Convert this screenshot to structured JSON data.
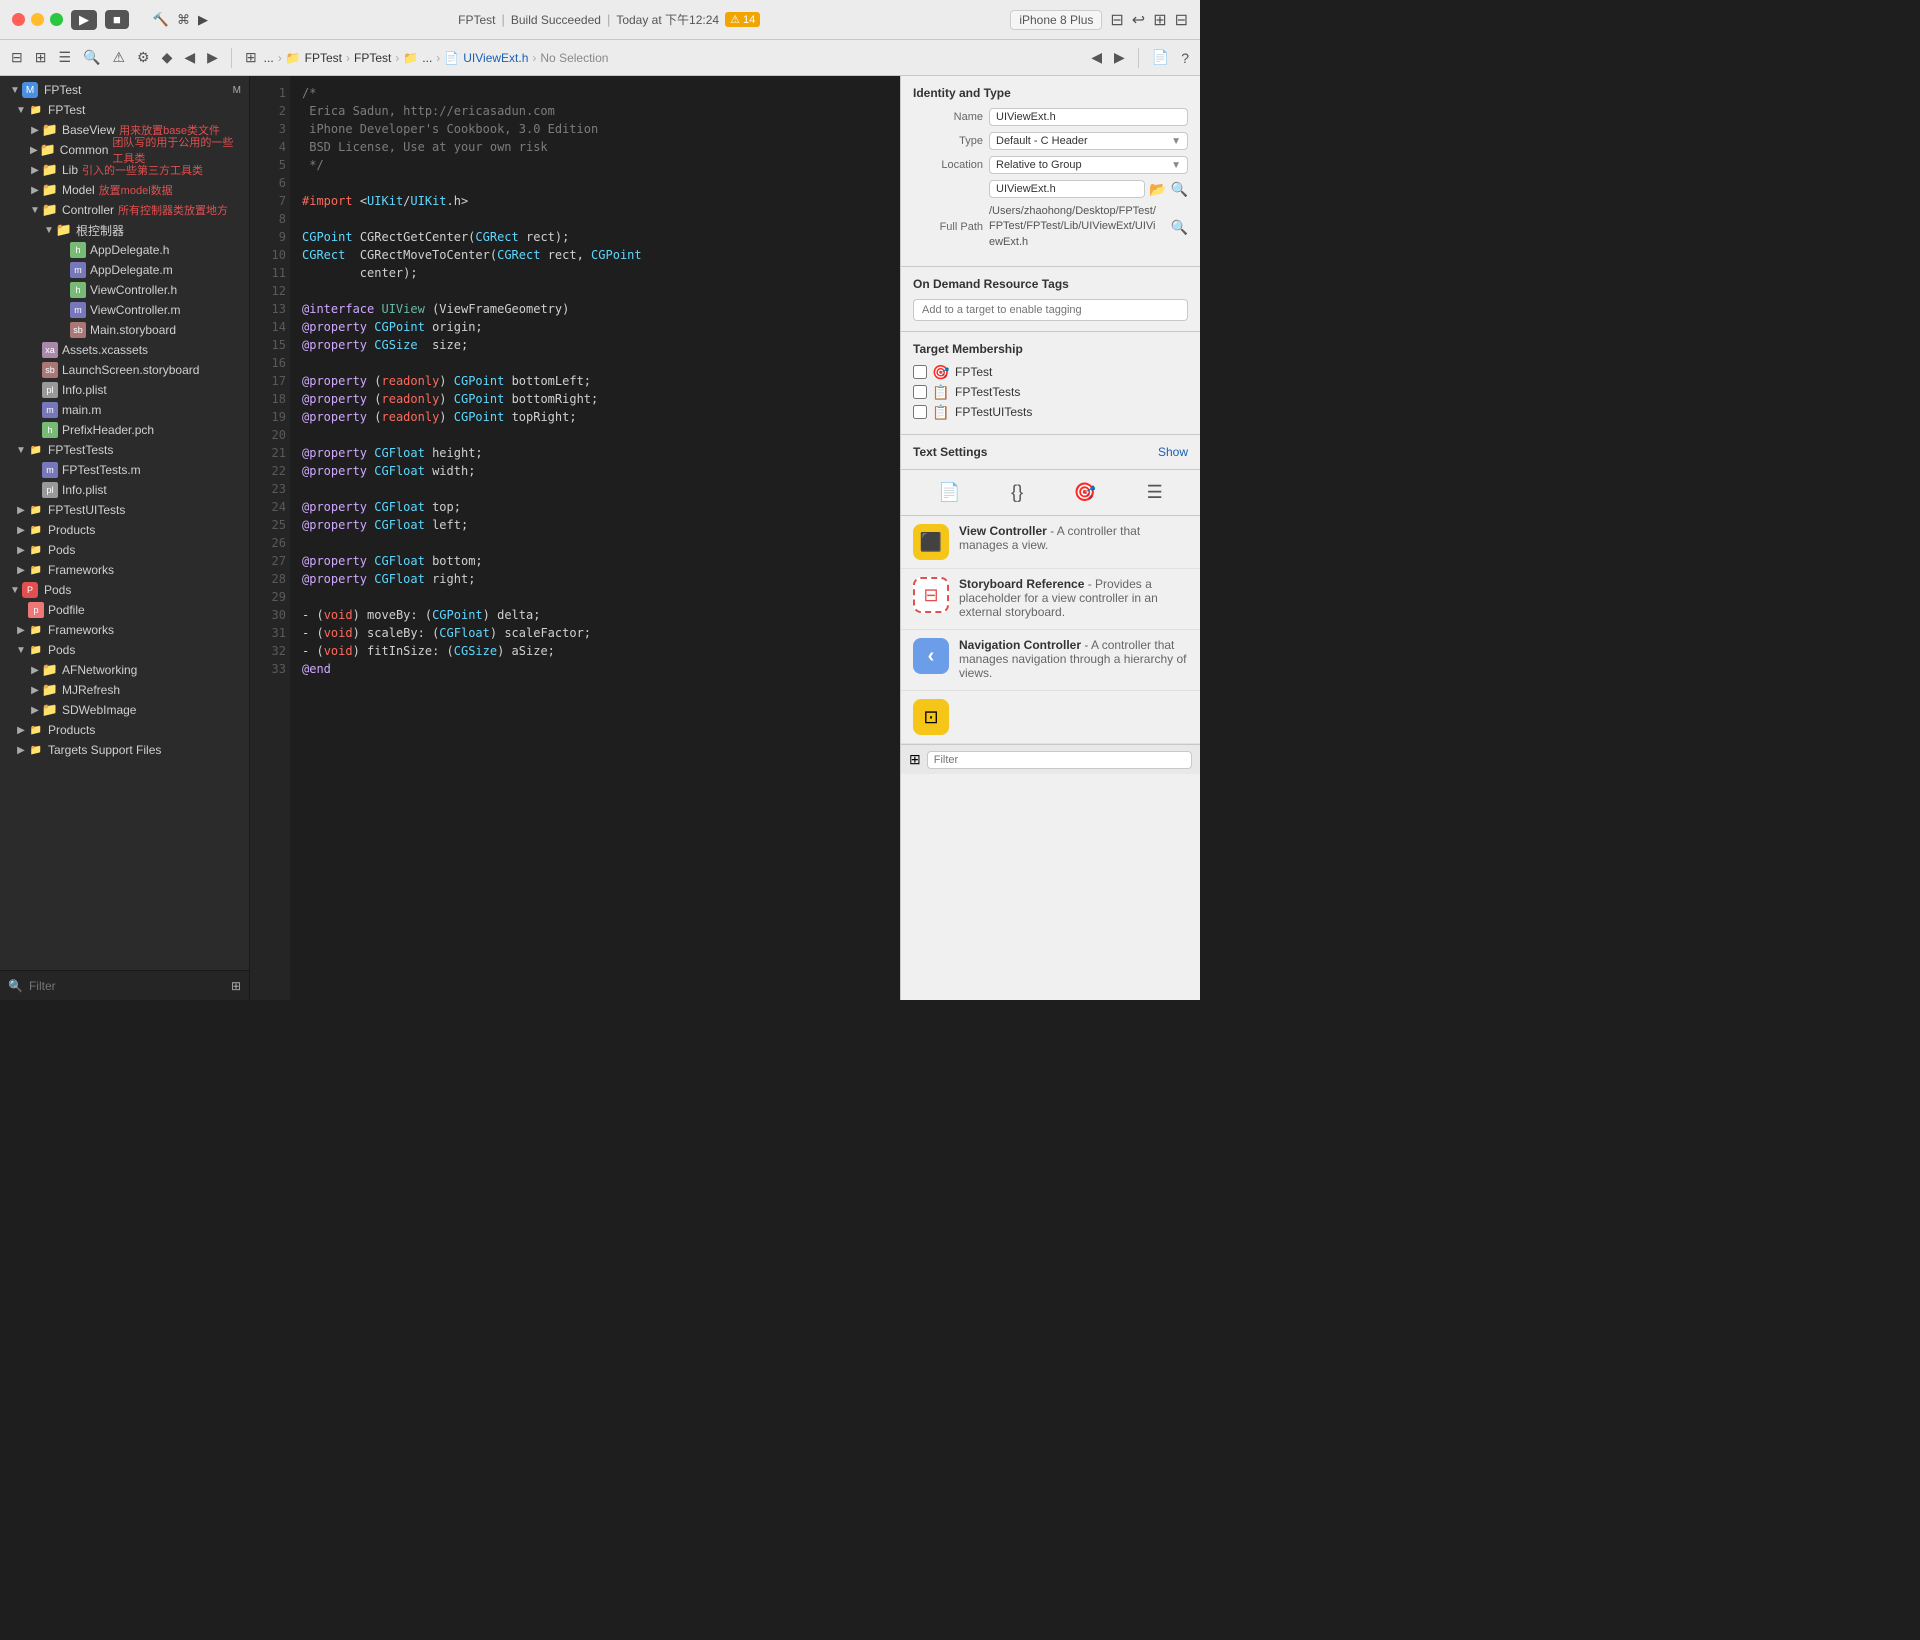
{
  "titleBar": {
    "appName": "FPTest",
    "buildStatus": "Build Succeeded",
    "timestamp": "Today at 下午12:24",
    "warningCount": "14",
    "device": "iPhone 8 Plus",
    "runLabel": "▶",
    "stopLabel": "■"
  },
  "breadcrumb": {
    "items": [
      "...",
      "FPTest",
      "FPTest",
      "UIViewExt.h"
    ],
    "noSelection": "No Selection"
  },
  "sidebar": {
    "title": "FPTest",
    "filterPlaceholder": "Filter",
    "tree": [
      {
        "label": "FPTest",
        "level": 0,
        "type": "root",
        "expanded": true
      },
      {
        "label": "FPTest",
        "level": 1,
        "type": "group",
        "expanded": true
      },
      {
        "label": "BaseView",
        "level": 2,
        "type": "folder",
        "expanded": false,
        "annotation": "用来放置base类文件"
      },
      {
        "label": "Common",
        "level": 2,
        "type": "folder",
        "expanded": false,
        "annotation": "团队写的用于公用的一些工具类"
      },
      {
        "label": "Lib",
        "level": 2,
        "type": "folder",
        "expanded": false,
        "annotation": "引入的一些第三方工具类"
      },
      {
        "label": "Model",
        "level": 2,
        "type": "folder",
        "expanded": false,
        "annotation": "放置model数据"
      },
      {
        "label": "Controller",
        "level": 2,
        "type": "folder",
        "expanded": true,
        "annotation": "所有控制器类放置地方"
      },
      {
        "label": "根控制器",
        "level": 3,
        "type": "folder",
        "expanded": true
      },
      {
        "label": "AppDelegate.h",
        "level": 4,
        "type": "h"
      },
      {
        "label": "AppDelegate.m",
        "level": 4,
        "type": "m"
      },
      {
        "label": "ViewController.h",
        "level": 4,
        "type": "h"
      },
      {
        "label": "ViewController.m",
        "level": 4,
        "type": "m"
      },
      {
        "label": "Main.storyboard",
        "level": 4,
        "type": "storyboard"
      },
      {
        "label": "Assets.xcassets",
        "level": 2,
        "type": "xcassets"
      },
      {
        "label": "LaunchScreen.storyboard",
        "level": 2,
        "type": "storyboard"
      },
      {
        "label": "Info.plist",
        "level": 2,
        "type": "plist"
      },
      {
        "label": "main.m",
        "level": 2,
        "type": "m"
      },
      {
        "label": "PrefixHeader.pch",
        "level": 2,
        "type": "h"
      },
      {
        "label": "FPTestTests",
        "level": 1,
        "type": "group",
        "expanded": true
      },
      {
        "label": "FPTestTests.m",
        "level": 2,
        "type": "m"
      },
      {
        "label": "Info.plist",
        "level": 2,
        "type": "plist"
      },
      {
        "label": "FPTestUITests",
        "level": 1,
        "type": "group",
        "expanded": false
      },
      {
        "label": "Products",
        "level": 1,
        "type": "group",
        "expanded": false
      },
      {
        "label": "Pods",
        "level": 1,
        "type": "group",
        "expanded": false
      },
      {
        "label": "Frameworks",
        "level": 1,
        "type": "group",
        "expanded": false
      },
      {
        "label": "Pods",
        "level": 0,
        "type": "root",
        "expanded": true
      },
      {
        "label": "Podfile",
        "level": 1,
        "type": "pod"
      },
      {
        "label": "Frameworks",
        "level": 1,
        "type": "group",
        "expanded": false
      },
      {
        "label": "Pods",
        "level": 1,
        "type": "group",
        "expanded": true
      },
      {
        "label": "AFNetworking",
        "level": 2,
        "type": "folder",
        "expanded": false
      },
      {
        "label": "MJRefresh",
        "level": 2,
        "type": "folder",
        "expanded": false
      },
      {
        "label": "SDWebImage",
        "level": 2,
        "type": "folder",
        "expanded": false
      },
      {
        "label": "Products",
        "level": 1,
        "type": "group",
        "expanded": false
      },
      {
        "label": "Targets Support Files",
        "level": 1,
        "type": "group",
        "expanded": false
      }
    ]
  },
  "codeEditor": {
    "filename": "UIViewExt.h",
    "lines": [
      {
        "n": 1,
        "code": "/*",
        "type": "comment"
      },
      {
        "n": 2,
        "code": " Erica Sadun, http://ericasadun.com",
        "type": "comment"
      },
      {
        "n": 3,
        "code": " iPhone Developer's Cookbook, 3.0 Edition",
        "type": "comment"
      },
      {
        "n": 4,
        "code": " BSD License, Use at your own risk",
        "type": "comment"
      },
      {
        "n": 5,
        "code": " */",
        "type": "comment"
      },
      {
        "n": 6,
        "code": "",
        "type": "normal"
      },
      {
        "n": 7,
        "code": "#import <UIKit/UIKit.h>",
        "type": "import"
      },
      {
        "n": 8,
        "code": "",
        "type": "normal"
      },
      {
        "n": 9,
        "code": "CGPoint CGRectGetCenter(CGRect rect);",
        "type": "normal"
      },
      {
        "n": 10,
        "code": "CGRect  CGRectMoveToCenter(CGRect rect, CGPoint center);",
        "type": "normal"
      },
      {
        "n": 11,
        "code": "",
        "type": "normal"
      },
      {
        "n": 12,
        "code": "@interface UIView (ViewFrameGeometry)",
        "type": "interface"
      },
      {
        "n": 13,
        "code": "@property CGPoint origin;",
        "type": "property"
      },
      {
        "n": 14,
        "code": "@property CGSize  size;",
        "type": "property"
      },
      {
        "n": 15,
        "code": "",
        "type": "normal"
      },
      {
        "n": 16,
        "code": "@property (readonly) CGPoint bottomLeft;",
        "type": "property"
      },
      {
        "n": 17,
        "code": "@property (readonly) CGPoint bottomRight;",
        "type": "property"
      },
      {
        "n": 18,
        "code": "@property (readonly) CGPoint topRight;",
        "type": "property"
      },
      {
        "n": 19,
        "code": "",
        "type": "normal"
      },
      {
        "n": 20,
        "code": "@property CGFloat height;",
        "type": "property"
      },
      {
        "n": 21,
        "code": "@property CGFloat width;",
        "type": "property"
      },
      {
        "n": 22,
        "code": "",
        "type": "normal"
      },
      {
        "n": 23,
        "code": "@property CGFloat top;",
        "type": "property"
      },
      {
        "n": 24,
        "code": "@property CGFloat left;",
        "type": "property"
      },
      {
        "n": 25,
        "code": "",
        "type": "normal"
      },
      {
        "n": 26,
        "code": "@property CGFloat bottom;",
        "type": "property"
      },
      {
        "n": 27,
        "code": "@property CGFloat right;",
        "type": "property"
      },
      {
        "n": 28,
        "code": "",
        "type": "normal"
      },
      {
        "n": 29,
        "code": "- (void) moveBy: (CGPoint) delta;",
        "type": "method"
      },
      {
        "n": 30,
        "code": "- (void) scaleBy: (CGFloat) scaleFactor;",
        "type": "method"
      },
      {
        "n": 31,
        "code": "- (void) fitInSize: (CGSize) aSize;",
        "type": "method"
      },
      {
        "n": 32,
        "code": "@end",
        "type": "keyword"
      },
      {
        "n": 33,
        "code": "",
        "type": "normal"
      }
    ]
  },
  "inspector": {
    "identityType": {
      "title": "Identity and Type",
      "nameLabel": "Name",
      "nameValue": "UIViewExt.h",
      "typeLabel": "Type",
      "typeValue": "Default - C Header",
      "locationLabel": "Location",
      "locationValue": "Relative to Group",
      "locationFile": "UIViewExt.h",
      "fullPathLabel": "Full Path",
      "fullPathValue": "/Users/zhaohong/Desktop/FPTest/FPTest/FPTest/Lib/UIViewExt/UIViewExt.h"
    },
    "onDemand": {
      "title": "On Demand Resource Tags",
      "placeholder": "Add to a target to enable tagging"
    },
    "targetMembership": {
      "title": "Target Membership",
      "targets": [
        {
          "name": "FPTest",
          "checked": false,
          "type": "app"
        },
        {
          "name": "FPTestTests",
          "checked": false,
          "type": "test"
        },
        {
          "name": "FPTestUITests",
          "checked": false,
          "type": "uitest"
        }
      ]
    },
    "textSettings": {
      "label": "Text Settings",
      "showLabel": "Show"
    },
    "tabs": [
      "📄",
      "{}",
      "🎯",
      "☰"
    ],
    "objectLibrary": [
      {
        "title": "View Controller",
        "desc": "- A controller that manages a view.",
        "iconType": "vc"
      },
      {
        "title": "Storyboard Reference",
        "desc": "- Provides a placeholder for a view controller in an external storyboard.",
        "iconType": "sb"
      },
      {
        "title": "Navigation Controller",
        "desc": "- A controller that manages navigation through a hierarchy of views.",
        "iconType": "nav"
      }
    ],
    "filterPlaceholder": "Filter"
  }
}
